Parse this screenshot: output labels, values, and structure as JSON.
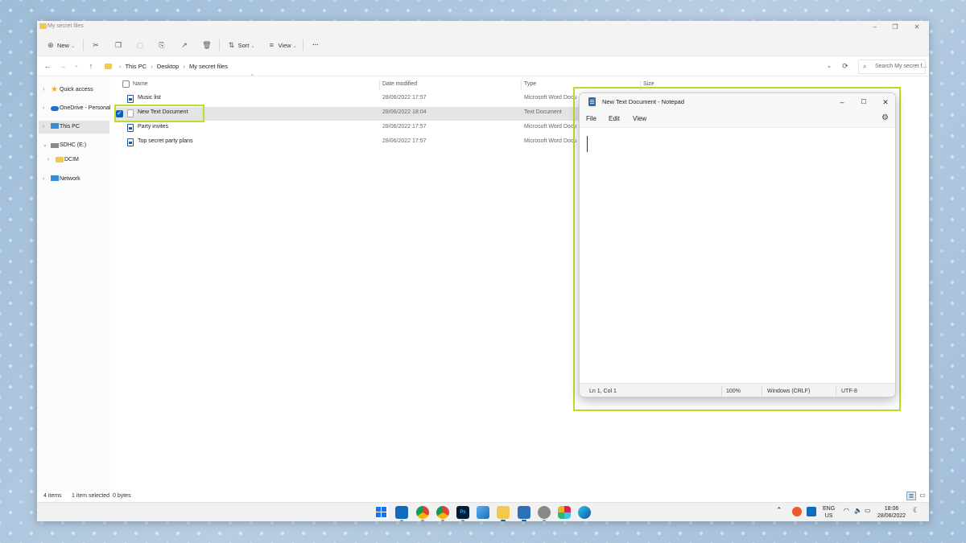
{
  "explorer": {
    "title": "My secret files",
    "toolbar": {
      "new_label": "New",
      "sort_label": "Sort",
      "view_label": "View",
      "more_label": "···"
    },
    "breadcrumb": [
      "This PC",
      "Desktop",
      "My secret files"
    ],
    "search_placeholder": "Search My secret f...",
    "sidebar": [
      {
        "label": "Quick access",
        "icon": "star-icon",
        "expandable": true
      },
      {
        "label": "OneDrive - Personal",
        "icon": "cloud-icon",
        "expandable": true
      },
      {
        "label": "This PC",
        "icon": "computer-icon",
        "expandable": true,
        "selected": true
      },
      {
        "label": "SDHC (E:)",
        "icon": "drive-icon",
        "expandable": true,
        "expanded": true
      },
      {
        "label": "DCIM",
        "icon": "folder-icon",
        "expandable": true
      },
      {
        "label": "Network",
        "icon": "network-icon",
        "expandable": true
      }
    ],
    "columns": {
      "name": "Name",
      "date": "Date modified",
      "type": "Type",
      "size": "Size"
    },
    "files": [
      {
        "name": "Music list",
        "date": "28/06/2022 17:57",
        "type": "Microsoft Word Docu",
        "icon": "word-doc-icon",
        "selected": false
      },
      {
        "name": "New Text Document",
        "date": "28/06/2022 18:04",
        "type": "Text Document",
        "icon": "text-doc-icon",
        "selected": true
      },
      {
        "name": "Party invites",
        "date": "28/06/2022 17:57",
        "type": "Microsoft Word Docu",
        "icon": "word-doc-icon",
        "selected": false
      },
      {
        "name": "Top secret party plans",
        "date": "28/06/2022 17:57",
        "type": "Microsoft Word Docu",
        "icon": "word-doc-icon",
        "selected": false
      }
    ],
    "status": {
      "items": "4 items",
      "selected": "1 item selected",
      "size": "0 bytes"
    }
  },
  "notepad": {
    "title": "New Text Document - Notepad",
    "menus": [
      "File",
      "Edit",
      "View"
    ],
    "content": "",
    "status": {
      "position": "Ln 1, Col 1",
      "zoom": "100%",
      "line_ending": "Windows (CRLF)",
      "encoding": "UTF-8"
    }
  },
  "taskbar": {
    "apps": [
      "windows-start-icon",
      "outlook-icon",
      "chrome-icon",
      "chrome-icon",
      "photoshop-icon",
      "photos-icon",
      "file-explorer-icon",
      "notepad-icon",
      "settings-icon",
      "slack-icon",
      "edge-icon"
    ],
    "language": "ENG",
    "region": "US",
    "time": "18:06",
    "date": "28/06/2022"
  },
  "colors": {
    "highlight": "#b7e02b",
    "accent": "#0a5fc2"
  }
}
